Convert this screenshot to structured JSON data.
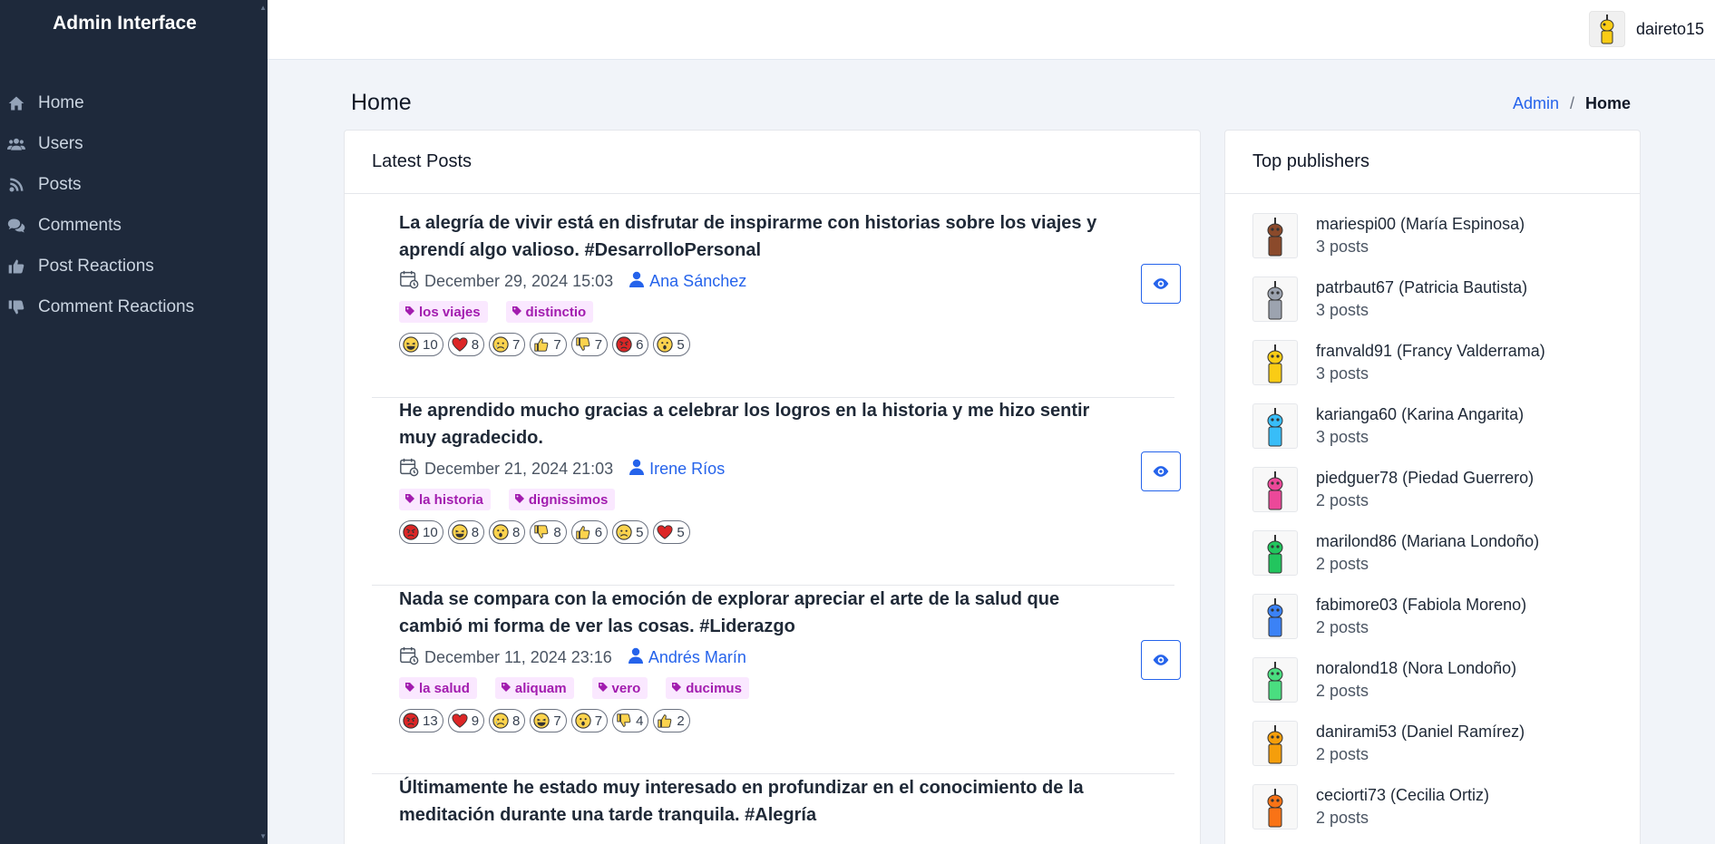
{
  "app": {
    "title": "Admin Interface"
  },
  "sidebar": {
    "items": [
      {
        "label": "Home",
        "icon": "home-icon"
      },
      {
        "label": "Users",
        "icon": "users-icon"
      },
      {
        "label": "Posts",
        "icon": "blog-icon"
      },
      {
        "label": "Comments",
        "icon": "comments-icon"
      },
      {
        "label": "Post Reactions",
        "icon": "thumbs-up-icon"
      },
      {
        "label": "Comment Reactions",
        "icon": "thumbs-down-icon"
      }
    ]
  },
  "topbar": {
    "username": "daireto15"
  },
  "header": {
    "title": "Home",
    "breadcrumb": {
      "root": "Admin",
      "current": "Home"
    }
  },
  "posts": {
    "title": "Latest Posts",
    "items": [
      {
        "title": "La alegría de vivir está en disfrutar de inspirarme con historias sobre los viajes y aprendí algo valioso. #DesarrolloPersonal",
        "date": "December 29, 2024 15:03",
        "author": "Ana Sánchez",
        "tags": [
          "los viajes",
          "distinctio"
        ],
        "reactions": [
          {
            "type": "laugh",
            "count": "10"
          },
          {
            "type": "heart",
            "count": "8"
          },
          {
            "type": "sad",
            "count": "7"
          },
          {
            "type": "like",
            "count": "7"
          },
          {
            "type": "dislike",
            "count": "7"
          },
          {
            "type": "angry",
            "count": "6"
          },
          {
            "type": "wow",
            "count": "5"
          }
        ]
      },
      {
        "title": "He aprendido mucho gracias a celebrar los logros en la historia y me hizo sentir muy agradecido.",
        "date": "December 21, 2024 21:03",
        "author": "Irene Ríos",
        "tags": [
          "la historia",
          "dignissimos"
        ],
        "reactions": [
          {
            "type": "angry",
            "count": "10"
          },
          {
            "type": "laugh",
            "count": "8"
          },
          {
            "type": "wow",
            "count": "8"
          },
          {
            "type": "dislike",
            "count": "8"
          },
          {
            "type": "like",
            "count": "6"
          },
          {
            "type": "sad",
            "count": "5"
          },
          {
            "type": "heart",
            "count": "5"
          }
        ]
      },
      {
        "title": "Nada se compara con la emoción de explorar apreciar el arte de la salud que cambió mi forma de ver las cosas. #Liderazgo",
        "date": "December 11, 2024 23:16",
        "author": "Andrés Marín",
        "tags": [
          "la salud",
          "aliquam",
          "vero",
          "ducimus"
        ],
        "reactions": [
          {
            "type": "angry",
            "count": "13"
          },
          {
            "type": "heart",
            "count": "9"
          },
          {
            "type": "sad",
            "count": "8"
          },
          {
            "type": "laugh",
            "count": "7"
          },
          {
            "type": "wow",
            "count": "7"
          },
          {
            "type": "dislike",
            "count": "4"
          },
          {
            "type": "like",
            "count": "2"
          }
        ]
      },
      {
        "title": "Últimamente he estado muy interesado en profundizar en el conocimiento de la meditación durante una tarde tranquila. #Alegría",
        "date": "",
        "author": "",
        "tags": [],
        "reactions": []
      }
    ]
  },
  "publishers": {
    "title": "Top publishers",
    "items": [
      {
        "name": "mariespi00 (María Espinosa)",
        "count": "3 posts",
        "color": "#8b4a2b"
      },
      {
        "name": "patrbaut67 (Patricia Bautista)",
        "count": "3 posts",
        "color": "#9ca3af"
      },
      {
        "name": "franvald91 (Francy Valderrama)",
        "count": "3 posts",
        "color": "#facc15"
      },
      {
        "name": "karianga60 (Karina Angarita)",
        "count": "3 posts",
        "color": "#38bdf8"
      },
      {
        "name": "piedguer78 (Piedad Guerrero)",
        "count": "2 posts",
        "color": "#ec4899"
      },
      {
        "name": "marilond86 (Mariana Londoño)",
        "count": "2 posts",
        "color": "#22c55e"
      },
      {
        "name": "fabimore03 (Fabiola Moreno)",
        "count": "2 posts",
        "color": "#3b82f6"
      },
      {
        "name": "noralond18 (Nora Londoño)",
        "count": "2 posts",
        "color": "#4ade80"
      },
      {
        "name": "danirami53 (Daniel Ramírez)",
        "count": "2 posts",
        "color": "#f59e0b"
      },
      {
        "name": "ceciorti73 (Cecilia Ortiz)",
        "count": "2 posts",
        "color": "#f97316"
      }
    ]
  }
}
